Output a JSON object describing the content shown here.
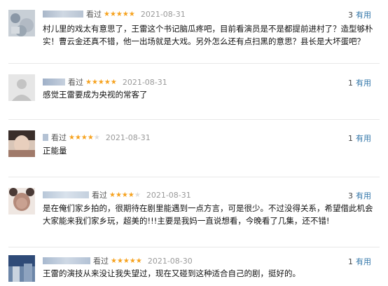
{
  "reviews": [
    {
      "watched": "看过",
      "stars": "★★★★★",
      "stars_off": "",
      "date": "2021-08-31",
      "useful_count": "3",
      "useful_label": "有用",
      "content": "村儿里的戏太有意思了，王雷这个书记脑瓜疼吧，目前看演员是不是都提前进村了？造型够朴实！曹云金还真不错，他一出场就是大戏。另外怎么还有点扫黑的意思？县长是大坏蛋吧？"
    },
    {
      "watched": "看过",
      "stars": "★★★★★",
      "stars_off": "",
      "date": "2021-08-31",
      "useful_count": "1",
      "useful_label": "有用",
      "content": "感觉王雷要成为央视的常客了"
    },
    {
      "watched": "看过",
      "stars": "★★★★",
      "stars_off": "★",
      "date": "2021-08-31",
      "useful_count": "1",
      "useful_label": "有用",
      "content": "正能量"
    },
    {
      "watched": "看过",
      "stars": "★★★★",
      "stars_off": "★",
      "date": "2021-08-31",
      "useful_count": "3",
      "useful_label": "有用",
      "content": "是在俺们家乡拍的，很期待在剧里能遇到一点方言，可是很少。不过没得关系，希望借此机会大家能来我们家乡玩，超美的!!!主要是我妈一直说想看，今晚看了几集，还不错!"
    },
    {
      "watched": "看过",
      "stars": "★★★★★",
      "stars_off": "",
      "date": "2021-08-30",
      "useful_count": "1",
      "useful_label": "有用",
      "content": "王雷的演技从来没让我失望过，现在又碰到这种适合自己的剧，挺好的。"
    }
  ],
  "colors": {
    "star": "#f6a21e",
    "link": "#3377aa",
    "divider": "#e8e8e8"
  }
}
